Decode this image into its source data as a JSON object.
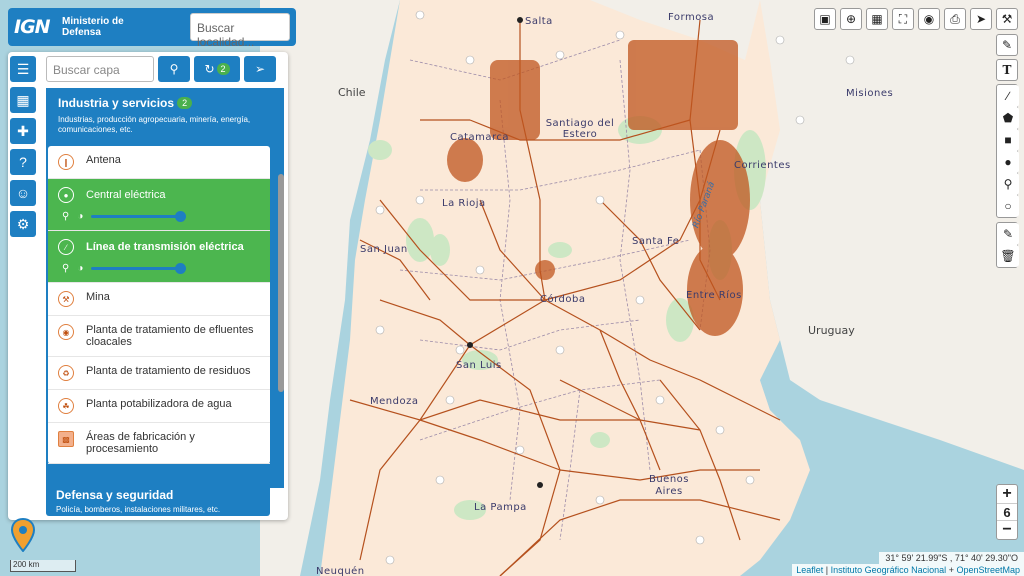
{
  "brand": {
    "logo": "IGN",
    "ministry": "Ministerio de Defensa",
    "search_placeholder": "Buscar localidad..."
  },
  "panel": {
    "search_placeholder": "Buscar capa",
    "sync_count": "2",
    "category": {
      "title": "Industria y servicios",
      "count": "2",
      "description": "Industrias, producción agropecuaria, minería, energía, comunicaciones, etc."
    },
    "layers": [
      {
        "label": "Antena",
        "icon": "antenna-icon",
        "active": false
      },
      {
        "label": "Central eléctrica",
        "icon": "power-plant-icon",
        "active": true
      },
      {
        "label": "Línea de transmisión eléctrica",
        "icon": "power-line-icon",
        "active": true
      },
      {
        "label": "Mina",
        "icon": "mine-icon",
        "active": false
      },
      {
        "label": "Planta de tratamiento de efluentes cloacales",
        "icon": "sewage-plant-icon",
        "active": false
      },
      {
        "label": "Planta de tratamiento de residuos",
        "icon": "waste-plant-icon",
        "active": false
      },
      {
        "label": "Planta potabilizadora de agua",
        "icon": "water-plant-icon",
        "active": false
      },
      {
        "label": "Áreas de fabricación y procesamiento",
        "icon": "manufacturing-area-icon",
        "active": false
      }
    ],
    "category2": {
      "title": "Defensa y seguridad",
      "description": "Policía, bomberos, instalaciones militares, etc."
    }
  },
  "map": {
    "labels": {
      "salta": "Salta",
      "formosa": "Formosa",
      "chile": "Chile",
      "misiones": "Misiones",
      "catamarca": "Catamarca",
      "santiago": "Santiago del Estero",
      "corrientes": "Corrientes",
      "la_rioja": "La Rioja",
      "santa_fe": "Santa Fe",
      "san_juan": "San Juan",
      "entre_rios": "Entre Ríos",
      "cordoba": "Córdoba",
      "uruguay": "Uruguay",
      "san_luis": "San Luis",
      "mendoza": "Mendoza",
      "buenos_aires": "Buenos Aires",
      "la_pampa": "La Pampa",
      "neuquen": "Neuquén",
      "rio_parana": "Río Paraná"
    },
    "zoom": "6",
    "coords": "31° 59' 21.99\"S , 71° 40' 29.30\"O",
    "scale": "200 km",
    "attribution": {
      "leaflet": "Leaflet",
      "ign": "Instituto Geográfico Nacional",
      "osm": "OpenStreetMap"
    }
  }
}
